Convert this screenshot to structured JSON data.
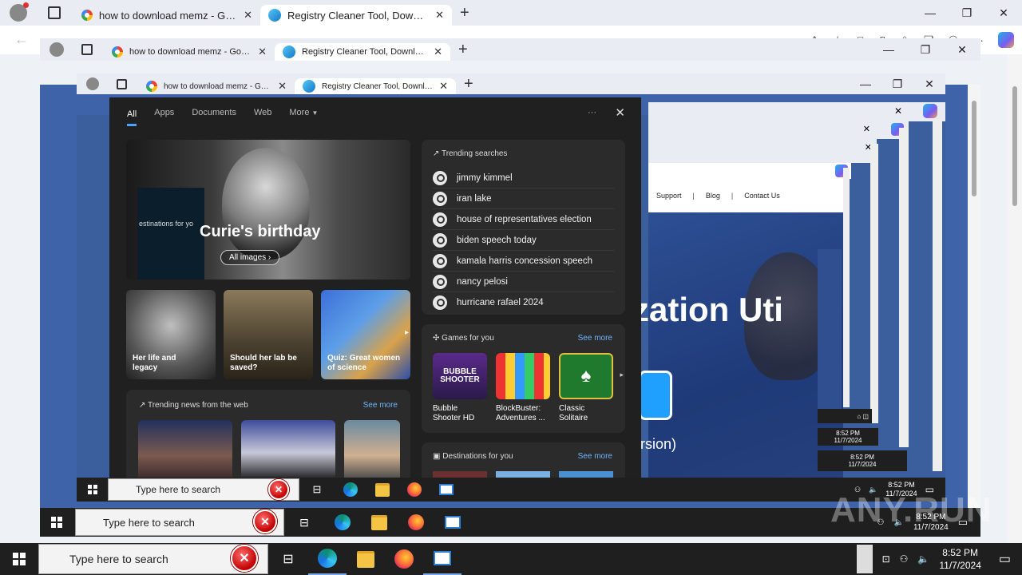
{
  "browser": {
    "tabs": [
      {
        "label": "how to download memz - Googl"
      },
      {
        "label": "Registry Cleaner Tool, Download"
      }
    ],
    "new_tab": "+",
    "controls": {
      "minimize": "—",
      "maximize": "❐",
      "close": "✕"
    }
  },
  "page": {
    "nav": {
      "support": "Support",
      "blog": "Blog",
      "contact": "Contact Us"
    },
    "hero_text": "zation Uti",
    "version_text": "rsion)"
  },
  "search": {
    "tabs": [
      "All",
      "Apps",
      "Documents",
      "Web",
      "More"
    ],
    "more_options": "···",
    "close": "✕",
    "hero": {
      "title": "Curie's birthday",
      "button": "All images",
      "overlay_text": "estinations for yo"
    },
    "tiles": [
      {
        "caption": "Her life and legacy"
      },
      {
        "caption": "Should her lab be saved?"
      },
      {
        "caption": "Quiz: Great women of science"
      }
    ],
    "trending": {
      "header": "Trending searches",
      "items": [
        "jimmy kimmel",
        "iran lake",
        "house of representatives election",
        "biden speech today",
        "kamala harris concession speech",
        "nancy pelosi",
        "hurricane rafael 2024"
      ]
    },
    "games": {
      "header": "Games for you",
      "see_more": "See more",
      "items": [
        {
          "name": "Bubble Shooter HD",
          "logo_text": "BUBBLE SHOOTER"
        },
        {
          "name": "BlockBuster: Adventures ..."
        },
        {
          "name": "Classic Solitaire"
        }
      ]
    },
    "news": {
      "header": "Trending news from the web",
      "see_more": "See more"
    },
    "destinations": {
      "header": "Destinations for you",
      "see_more": "See more"
    }
  },
  "taskbar": {
    "search_placeholder": "Type here to search",
    "time": "8:52 PM",
    "date": "11/7/2024",
    "mini_time": "8:52 PM",
    "mini_date": "11/7/2024"
  },
  "watermark": "ANY.RUN"
}
